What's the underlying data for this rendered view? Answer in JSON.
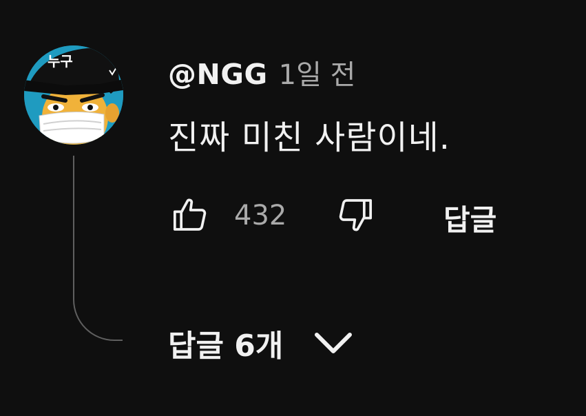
{
  "comment": {
    "avatar": {
      "icon": "masked-cartoon-avatar-icon",
      "cap_text": "누구"
    },
    "author": "@NGG",
    "timestamp": "1일 전",
    "text": "진짜 미친 사람이네.",
    "like_count": "432",
    "reply_label": "답글",
    "replies_toggle_label": "답글 6개"
  },
  "colors": {
    "background": "#0f0f0f",
    "primary_text": "#f1f1f1",
    "secondary_text": "#aaaaaa",
    "thread_line": "#5f5f5f",
    "avatar_bg": "#1f9bc0"
  },
  "icons": {
    "like": "thumb-up-icon",
    "dislike": "thumb-down-icon",
    "expand": "chevron-down-icon"
  }
}
